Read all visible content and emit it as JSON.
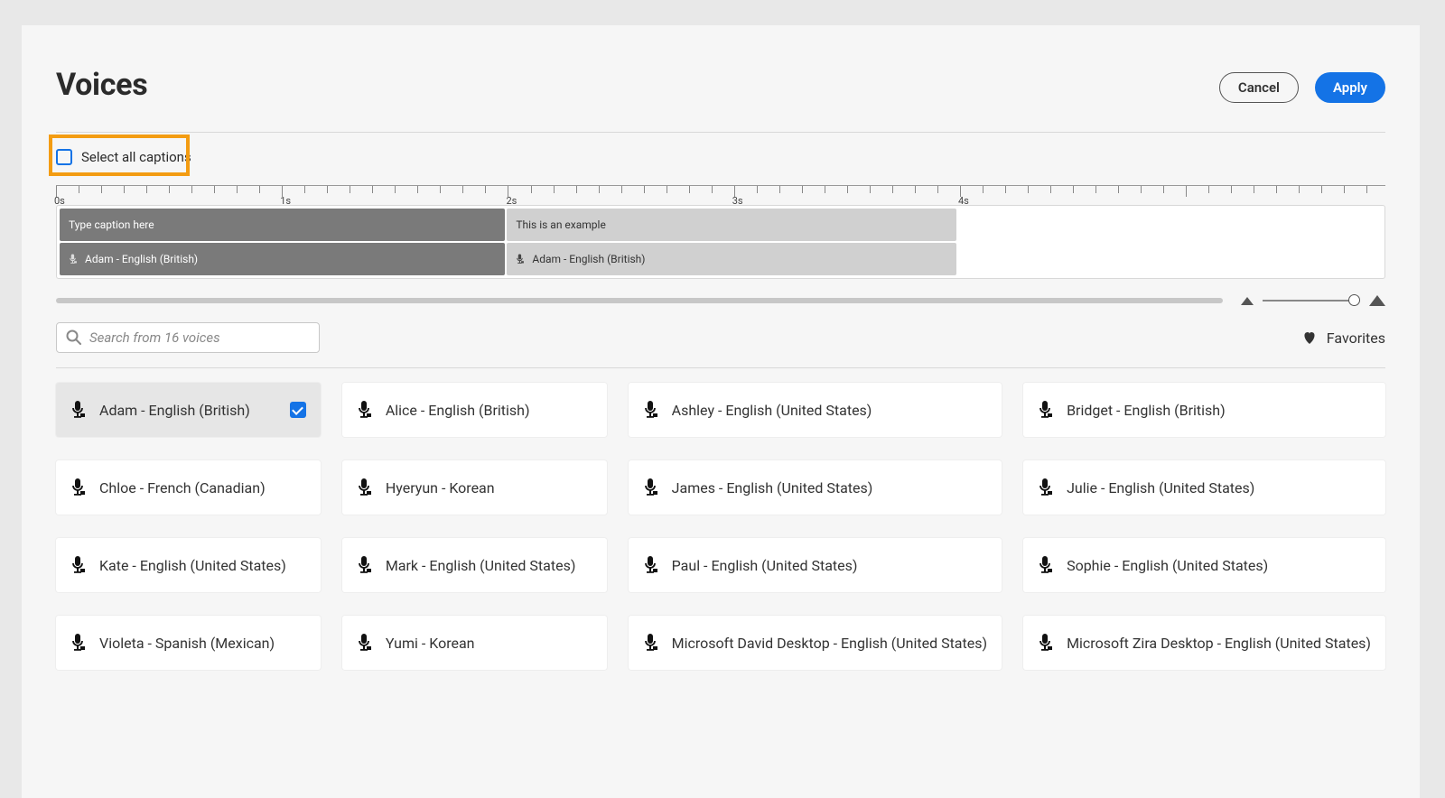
{
  "header": {
    "title": "Voices",
    "cancel": "Cancel",
    "apply": "Apply"
  },
  "select_all": {
    "label": "Select all captions"
  },
  "ruler": {
    "labels": [
      "0s",
      "1s",
      "2s",
      "3s",
      "4s"
    ]
  },
  "segments": {
    "seg1_text": "Type caption here",
    "seg2_text": "This is an example",
    "seg1_voice": "Adam - English (British)",
    "seg2_voice": "Adam - English (British)"
  },
  "search": {
    "placeholder": "Search from 16 voices"
  },
  "favorites": {
    "label": "Favorites"
  },
  "voices": [
    {
      "label": "Adam - English (British)",
      "selected": true
    },
    {
      "label": "Alice - English (British)",
      "selected": false
    },
    {
      "label": "Ashley - English (United States)",
      "selected": false
    },
    {
      "label": "Bridget - English (British)",
      "selected": false
    },
    {
      "label": "Chloe - French (Canadian)",
      "selected": false
    },
    {
      "label": "Hyeryun - Korean",
      "selected": false
    },
    {
      "label": "James - English (United States)",
      "selected": false
    },
    {
      "label": "Julie - English (United States)",
      "selected": false
    },
    {
      "label": "Kate - English (United States)",
      "selected": false
    },
    {
      "label": "Mark - English (United States)",
      "selected": false
    },
    {
      "label": "Paul - English (United States)",
      "selected": false
    },
    {
      "label": "Sophie - English (United States)",
      "selected": false
    },
    {
      "label": "Violeta - Spanish (Mexican)",
      "selected": false
    },
    {
      "label": "Yumi - Korean",
      "selected": false
    },
    {
      "label": "Microsoft David Desktop - English (United States)",
      "selected": false
    },
    {
      "label": "Microsoft Zira Desktop - English (United States)",
      "selected": false
    }
  ]
}
